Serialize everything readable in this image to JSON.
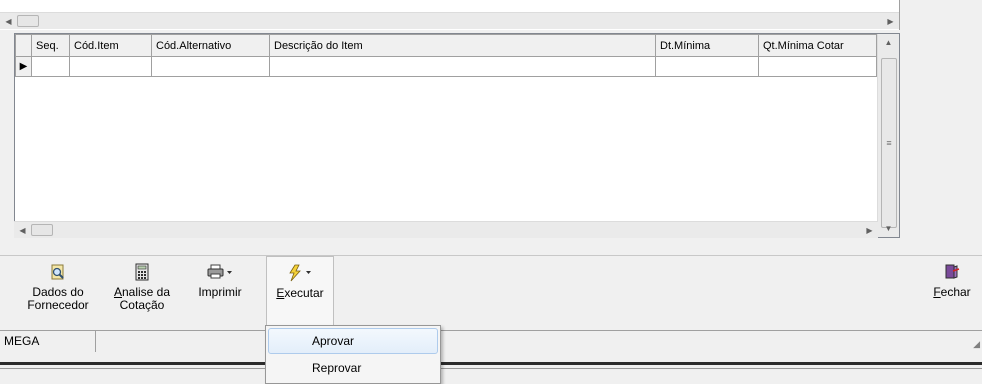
{
  "grid": {
    "columns": [
      "Seq.",
      "Cód.Item",
      "Cód.Alternativo",
      "Descrição do Item",
      "Dt.Mínima",
      "Qt.Mínima Cotar"
    ],
    "current_row_indicator": "▶"
  },
  "toolbar": {
    "dados_fornecedor": {
      "line1": "Dados do",
      "line2": "Fornecedor"
    },
    "analise_cotacao": {
      "line1_u": "A",
      "line1_rest": "nalise da",
      "line2": "Cotação"
    },
    "imprimir": "Imprimir",
    "executar": {
      "u": "E",
      "rest": "xecutar"
    },
    "fechar": {
      "u": "F",
      "rest": "echar"
    }
  },
  "statusbar": {
    "pane1": "MEGA"
  },
  "menu": {
    "items": [
      "Aprovar",
      "Reprovar"
    ]
  }
}
